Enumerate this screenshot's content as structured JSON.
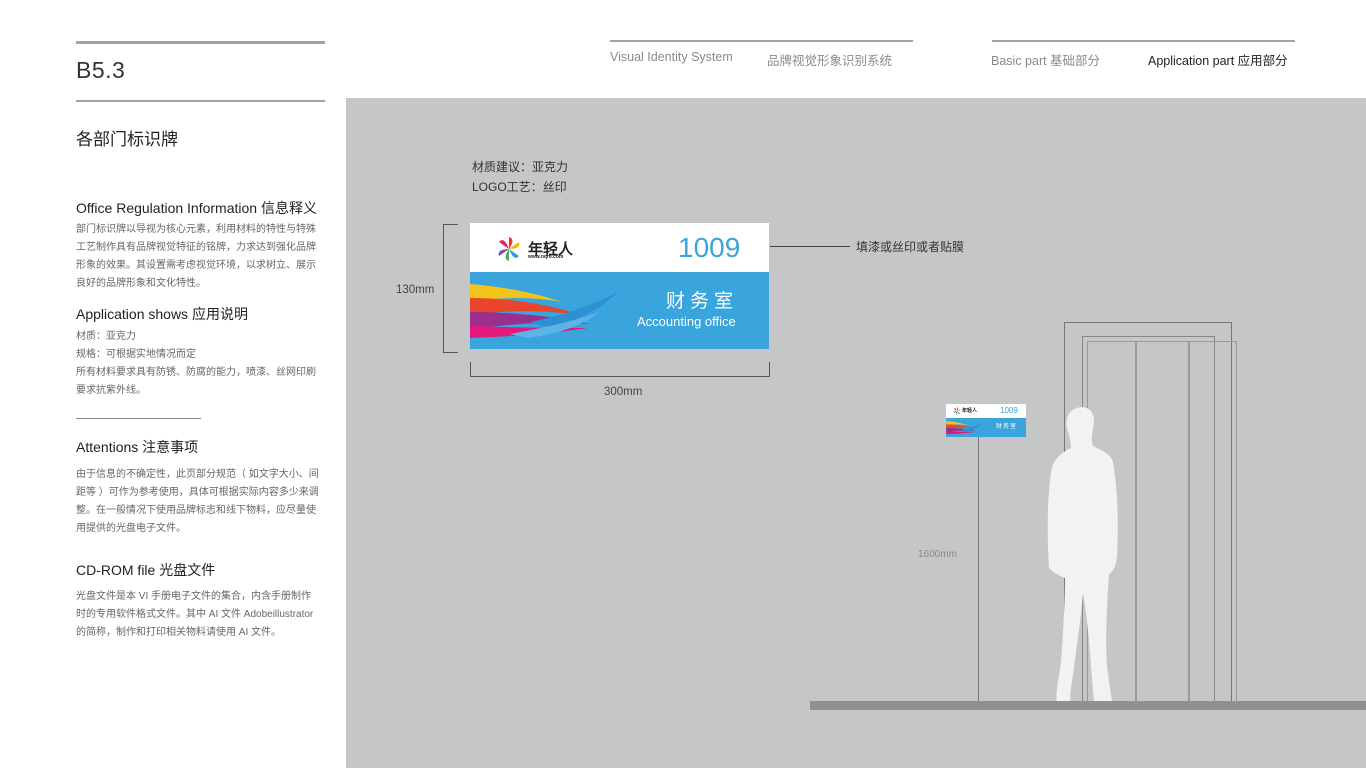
{
  "header": {
    "page_code": "B5.3",
    "vis_en": "Visual Identity System",
    "vis_cn": "品牌视觉形象识别系统",
    "basic_part": "Basic part  基础部分",
    "application_part": "Application part  应用部分"
  },
  "left": {
    "page_title": "各部门标识牌",
    "sections": [
      {
        "title": "Office Regulation Information 信息释义",
        "lines": [
          "部门标识牌以导视为核心元素，利用材料的特性与特殊",
          "工艺制作具有品牌视觉特征的铭牌，力求达到强化品牌",
          "形象的效果。其设置需考虑视觉环境，以求树立、展示",
          "良好的品牌形象和文化特性。"
        ]
      },
      {
        "title": "Application shows 应用说明",
        "lines": [
          "材质：亚克力",
          "规格：可根据实地情况而定",
          "所有材料要求具有防锈、防腐的能力，喷漆、丝网印刷",
          "要求抗紫外线。"
        ]
      },
      {
        "title": "Attentions 注意事项",
        "lines": [
          "由于信息的不确定性，此页部分规范（ 如文字大小、间",
          "距等 ）可作为参考使用，具体可根据实际内容多少来调",
          "整。在一般情况下使用品牌标志和线下物料，应尽量使",
          "用提供的光盘电子文件。"
        ]
      },
      {
        "title": "CD-ROM file 光盘文件",
        "lines": [
          "光盘文件是本 VI 手册电子文件的集合，内含手册制作",
          "时的专用软件格式文件。其中 AI 文件 Adobeillustrator",
          "的简称，制作和打印相关物料请使用 AI 文件。"
        ]
      }
    ]
  },
  "stage": {
    "material_note": "材质建议：亚克力",
    "logo_note": "LOGO工艺：丝印",
    "finish_note": "填漆或丝印或者贴膜",
    "height_label": "130mm",
    "width_label": "300mm",
    "mount_height_label": "1600mm"
  },
  "sign": {
    "logo_text": "年轻人",
    "logo_url": "www.nqr6.com",
    "room_number": "1009",
    "dept_cn": "财务室",
    "dept_en": "Accounting office"
  },
  "colors": {
    "sign_blue": "#3aa4dc",
    "stage_gray": "#c5c6c8",
    "bar_gray": "#a3a3a3"
  }
}
